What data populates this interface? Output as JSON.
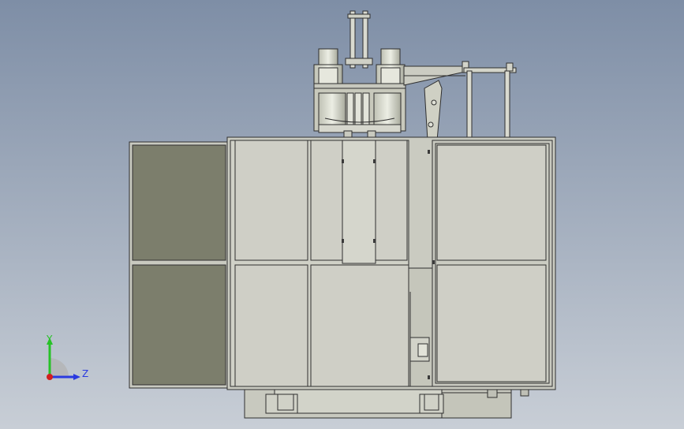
{
  "viewport": {
    "background_top": "#7e8ea6",
    "background_bottom": "#c8ced6"
  },
  "colors": {
    "panel_light": "#cfcfc6",
    "panel_mid": "#c4c4ba",
    "panel_dark": "#7c7e6c",
    "edge": "#2f2f2f",
    "metal": "#d9dad0"
  },
  "triad": {
    "y_label": "Y",
    "z_label": "Z",
    "y_color": "#27c227",
    "z_color": "#2a3ae0",
    "x_color": "#d21e1e"
  }
}
